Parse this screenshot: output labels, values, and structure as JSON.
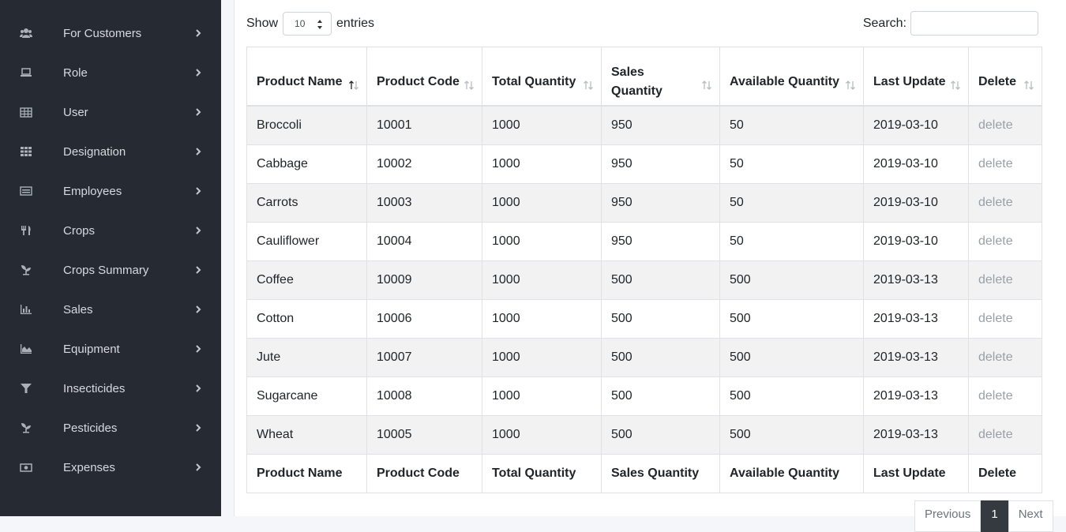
{
  "sidebar": {
    "items": [
      {
        "label": "For Customers",
        "icon": "users-icon"
      },
      {
        "label": "Role",
        "icon": "laptop-icon"
      },
      {
        "label": "User",
        "icon": "table-icon"
      },
      {
        "label": "Designation",
        "icon": "grid-icon"
      },
      {
        "label": "Employees",
        "icon": "id-card-icon"
      },
      {
        "label": "Crops",
        "icon": "utensils-icon"
      },
      {
        "label": "Crops Summary",
        "icon": "seedling-icon"
      },
      {
        "label": "Sales",
        "icon": "bar-chart-icon"
      },
      {
        "label": "Equipment",
        "icon": "area-chart-icon"
      },
      {
        "label": "Insecticides",
        "icon": "filter-icon"
      },
      {
        "label": "Pesticides",
        "icon": "seedling-icon"
      },
      {
        "label": "Expenses",
        "icon": "money-icon"
      }
    ]
  },
  "controls": {
    "show_label": "Show",
    "entries_value": "10",
    "entries_label": "entries",
    "search_label": "Search:",
    "search_value": ""
  },
  "table": {
    "headers": [
      "Product Name",
      "Product Code",
      "Total Quantity",
      "Sales Quantity",
      "Available Quantity",
      "Last Update",
      "Delete"
    ],
    "rows": [
      [
        "Broccoli",
        "10001",
        "1000",
        "950",
        "50",
        "2019-03-10",
        "delete"
      ],
      [
        "Cabbage",
        "10002",
        "1000",
        "950",
        "50",
        "2019-03-10",
        "delete"
      ],
      [
        "Carrots",
        "10003",
        "1000",
        "950",
        "50",
        "2019-03-10",
        "delete"
      ],
      [
        "Cauliflower",
        "10004",
        "1000",
        "950",
        "50",
        "2019-03-10",
        "delete"
      ],
      [
        "Coffee",
        "10009",
        "1000",
        "500",
        "500",
        "2019-03-13",
        "delete"
      ],
      [
        "Cotton",
        "10006",
        "1000",
        "500",
        "500",
        "2019-03-13",
        "delete"
      ],
      [
        "Jute",
        "10007",
        "1000",
        "500",
        "500",
        "2019-03-13",
        "delete"
      ],
      [
        "Sugarcane",
        "10008",
        "1000",
        "500",
        "500",
        "2019-03-13",
        "delete"
      ],
      [
        "Wheat",
        "10005",
        "1000",
        "500",
        "500",
        "2019-03-13",
        "delete"
      ]
    ],
    "footers": [
      "Product Name",
      "Product Code",
      "Total Quantity",
      "Sales Quantity",
      "Available Quantity",
      "Last Update",
      "Delete"
    ]
  },
  "pagination": {
    "previous": "Previous",
    "current": "1",
    "next": "Next"
  }
}
